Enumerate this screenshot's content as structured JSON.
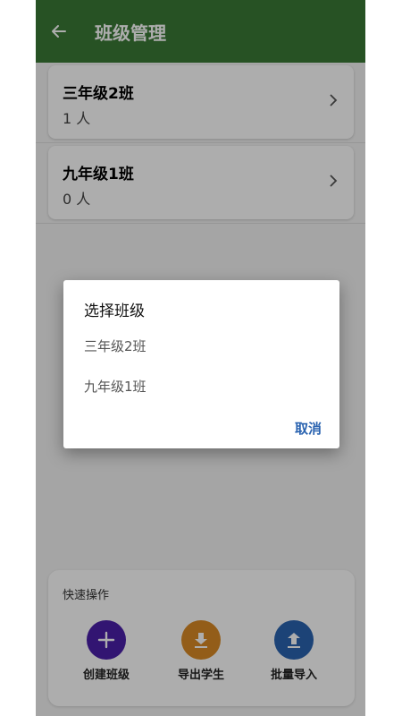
{
  "app_bar": {
    "title": "班级管理",
    "bg_color": "#3a7a35"
  },
  "classes": [
    {
      "name": "三年级2班",
      "count": "1 人"
    },
    {
      "name": "九年级1班",
      "count": "0 人"
    }
  ],
  "quick_actions": {
    "title": "快速操作",
    "items": [
      {
        "label": "创建班级",
        "icon": "plus-icon",
        "color": "#4a1fa8"
      },
      {
        "label": "导出学生",
        "icon": "download-icon",
        "color": "#d98a25"
      },
      {
        "label": "批量导入",
        "icon": "upload-icon",
        "color": "#2a63b0"
      }
    ]
  },
  "dialog": {
    "title": "选择班级",
    "options": [
      "三年级2班",
      "九年级1班"
    ],
    "cancel_label": "取消"
  }
}
